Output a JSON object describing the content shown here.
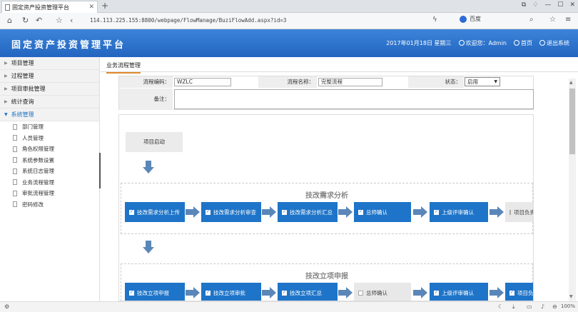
{
  "browser": {
    "tab_title": "固定资产投资管理平台",
    "url": "114.113.225.155:8800/webpage/FlowManage/BuziFlowAdd.aspx?id=3",
    "search_engine": "百度",
    "zoom": "100%"
  },
  "header": {
    "title": "固定资产投资管理平台",
    "date": "2017年01月18日 星期三",
    "welcome": "欢迎您：Admin",
    "home": "首页",
    "logout": "退出系统"
  },
  "sidebar": {
    "groups": [
      {
        "label": "项目管理"
      },
      {
        "label": "过程管理"
      },
      {
        "label": "项目审批管理"
      },
      {
        "label": "统计查询"
      },
      {
        "label": "系统管理"
      }
    ],
    "items": [
      {
        "label": "部门管理"
      },
      {
        "label": "人员管理"
      },
      {
        "label": "角色权限管理"
      },
      {
        "label": "系统参数设置"
      },
      {
        "label": "系统日志管理"
      },
      {
        "label": "业务流程管理"
      },
      {
        "label": "审批流程管理"
      },
      {
        "label": "密码修改"
      }
    ]
  },
  "content": {
    "tab": "业务流程管理",
    "form": {
      "code_label": "流程编码：",
      "code_value": "WZLC",
      "name_label": "流程名称：",
      "name_value": "完整流程",
      "status_label": "状态：",
      "status_value": "启用",
      "remark_label": "备注："
    },
    "flow": {
      "start": "项目启动",
      "groups": [
        {
          "title": "技改需求分析",
          "steps": [
            {
              "label": "技改需求分析上传",
              "checked": true
            },
            {
              "label": "技改需求分析审查",
              "checked": true
            },
            {
              "label": "技改需求分析汇总",
              "checked": true
            },
            {
              "label": "总师确认",
              "checked": true
            },
            {
              "label": "上级评审确认",
              "checked": true
            },
            {
              "label": "项目负责人确认",
              "checked": false
            }
          ]
        },
        {
          "title": "技改立项申报",
          "steps": [
            {
              "label": "技改立项申报",
              "checked": true
            },
            {
              "label": "技改立项审批",
              "checked": true
            },
            {
              "label": "技改立项汇总",
              "checked": true
            },
            {
              "label": "总师确认",
              "checked": false
            },
            {
              "label": "上级评审确认",
              "checked": true
            },
            {
              "label": "项目负责人确认",
              "checked": true
            }
          ]
        }
      ]
    }
  }
}
